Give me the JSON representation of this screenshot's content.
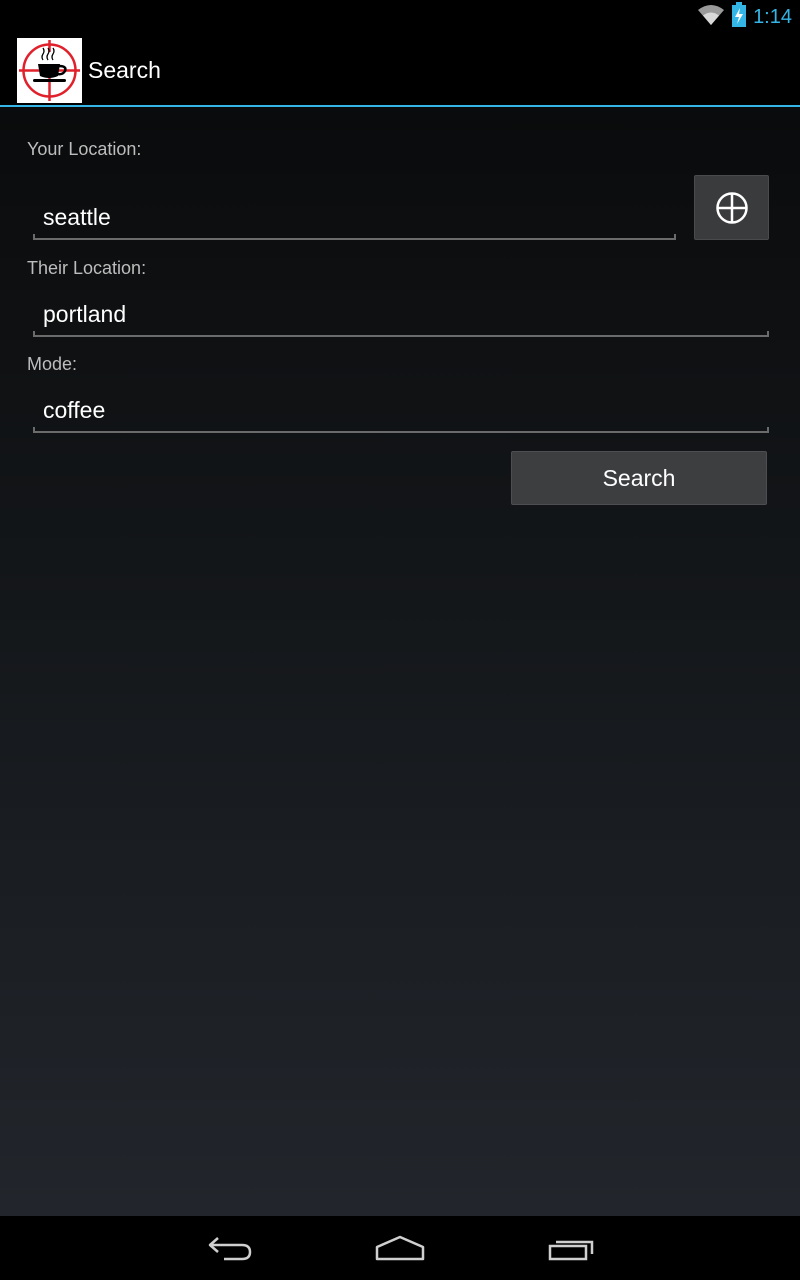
{
  "status_bar": {
    "time": "1:14",
    "wifi_icon": "wifi-icon",
    "battery_icon": "battery-charging-icon"
  },
  "action_bar": {
    "title": "Search",
    "app_icon": "coffee-target-logo"
  },
  "form": {
    "your_location_label": "Your Location:",
    "your_location_value": "seattle",
    "locate_icon": "crosshair-icon",
    "their_location_label": "Their Location:",
    "their_location_value": "portland",
    "mode_label": "Mode:",
    "mode_value": "coffee",
    "search_label": "Search"
  },
  "nav_bar": {
    "back_icon": "back-icon",
    "home_icon": "home-icon",
    "recents_icon": "recent-apps-icon"
  },
  "colors": {
    "accent": "#33b5e5",
    "button_bg": "#3d3e40"
  }
}
